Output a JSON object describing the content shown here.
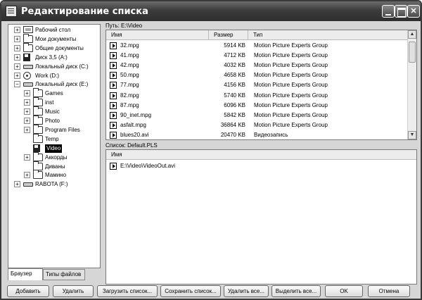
{
  "window": {
    "title": "Редактирование списка"
  },
  "tree": {
    "items": [
      {
        "label": "Рабочий стол",
        "icon": "desktop-icon",
        "expander": "+"
      },
      {
        "label": "Мои документы",
        "icon": "folder-icon",
        "expander": "+"
      },
      {
        "label": "Общие документы",
        "icon": "folder-icon",
        "expander": "+"
      },
      {
        "label": "Диск 3,5 (A:)",
        "icon": "floppy-drive-icon",
        "expander": "+"
      },
      {
        "label": "Локальный диск (C:)",
        "icon": "hard-drive-icon",
        "expander": "+"
      },
      {
        "label": "Work (D:)",
        "icon": "cd-drive-icon",
        "expander": "+"
      },
      {
        "label": "Локальный диск (E:)",
        "icon": "hard-drive-icon",
        "expander": "−"
      },
      {
        "label": "Games",
        "icon": "folder-icon",
        "expander": "+"
      },
      {
        "label": "inst",
        "icon": "folder-icon",
        "expander": "+"
      },
      {
        "label": "Music",
        "icon": "music-folder-icon",
        "expander": "+"
      },
      {
        "label": "Photo",
        "icon": "photo-folder-icon",
        "expander": "+"
      },
      {
        "label": "Program Files",
        "icon": "folder-icon",
        "expander": "+"
      },
      {
        "label": "Temp",
        "icon": "folder-icon",
        "expander": ""
      },
      {
        "label": "Video",
        "icon": "video-folder-icon",
        "expander": ""
      },
      {
        "label": "Аккорды",
        "icon": "folder-icon",
        "expander": "+"
      },
      {
        "label": "Диваны",
        "icon": "folder-icon",
        "expander": ""
      },
      {
        "label": "Мамино",
        "icon": "folder-icon",
        "expander": "+"
      },
      {
        "label": "RABOTA (F:)",
        "icon": "network-drive-icon",
        "expander": "+"
      }
    ]
  },
  "tabs": [
    "Браузер",
    "Типы файлов"
  ],
  "files": {
    "path_label": "Путь: E:\\Video",
    "columns": [
      "Имя",
      "Размер",
      "Тип"
    ],
    "rows": [
      {
        "name": "32.mpg",
        "size": "5914 KB",
        "type": "Motion Picture Experts Group"
      },
      {
        "name": "41.mpg",
        "size": "4712 KB",
        "type": "Motion Picture Experts Group"
      },
      {
        "name": "42.mpg",
        "size": "4032 KB",
        "type": "Motion Picture Experts Group"
      },
      {
        "name": "50.mpg",
        "size": "4658 KB",
        "type": "Motion Picture Experts Group"
      },
      {
        "name": "77.mpg",
        "size": "4156 KB",
        "type": "Motion Picture Experts Group"
      },
      {
        "name": "82.mpg",
        "size": "5740 KB",
        "type": "Motion Picture Experts Group"
      },
      {
        "name": "87.mpg",
        "size": "6096 KB",
        "type": "Motion Picture Experts Group"
      },
      {
        "name": "90_inet.mpg",
        "size": "5842 KB",
        "type": "Motion Picture Experts Group"
      },
      {
        "name": "asfalt.mpg",
        "size": "36864 KB",
        "type": "Motion Picture Experts Group"
      },
      {
        "name": "blues20.avi",
        "size": "20470 KB",
        "type": "Видеозапись"
      }
    ]
  },
  "playlist": {
    "label": "Список: Default.PLS",
    "columns": [
      "Имя"
    ],
    "rows": [
      {
        "name": "E:\\Video\\VideoOut.avi"
      }
    ]
  },
  "buttons": [
    "Добавить",
    "Удалить",
    "Загрузить список...",
    "Сохранить список...",
    "Удалить все...",
    "Выделить все...",
    "OK",
    "Отмена"
  ]
}
